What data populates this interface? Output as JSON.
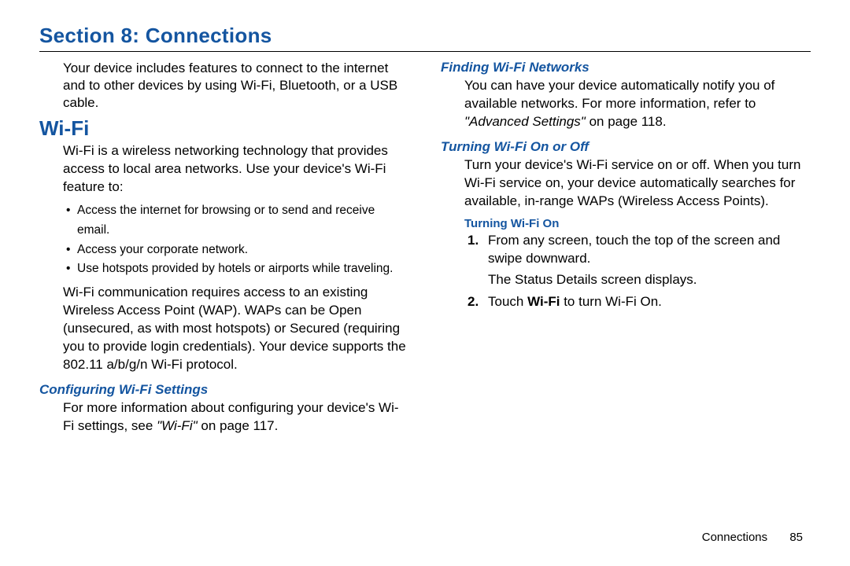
{
  "section_title": "Section 8: Connections",
  "left": {
    "intro": "Your device includes features to connect to the internet and to other devices by using Wi-Fi, Bluetooth, or a USB cable.",
    "wifi_heading": "Wi-Fi",
    "wifi_body1": "Wi-Fi is a wireless networking technology that provides access to local area networks. Use your device's Wi-Fi feature to:",
    "bullets": [
      "Access the internet for browsing or to send and receive email.",
      "Access your corporate network.",
      "Use hotspots provided by hotels or airports while traveling."
    ],
    "wifi_body2": "Wi-Fi communication requires access to an existing Wireless Access Point (WAP). WAPs can be Open (unsecured, as with most hotspots) or Secured (requiring you to provide login credentials). Your device supports the 802.11 a/b/g/n Wi-Fi protocol.",
    "config_heading": "Configuring Wi-Fi Settings",
    "config_body_pre": "For more information about configuring your device's Wi-Fi settings, see ",
    "config_ref": "\"Wi-Fi\"",
    "config_body_post": " on page 117."
  },
  "right": {
    "finding_heading": "Finding Wi-Fi Networks",
    "finding_body_pre": "You can have your device automatically notify you of available networks. For more information, refer to ",
    "finding_ref": "\"Advanced Settings\"",
    "finding_body_post": " on page 118.",
    "turning_heading": "Turning Wi-Fi On or Off",
    "turning_body": "Turn your device's Wi-Fi service on or off. When you turn Wi-Fi service on, your device automatically searches for available, in-range WAPs (Wireless Access Points).",
    "turning_on_heading": "Turning Wi-Fi On",
    "step1_main": "From any screen, touch the top of the screen and swipe downward.",
    "step1_sub": "The Status Details screen displays.",
    "step2_pre": "Touch ",
    "step2_bold": "Wi-Fi",
    "step2_post": " to turn Wi-Fi On."
  },
  "footer": {
    "section": "Connections",
    "page": "85"
  }
}
